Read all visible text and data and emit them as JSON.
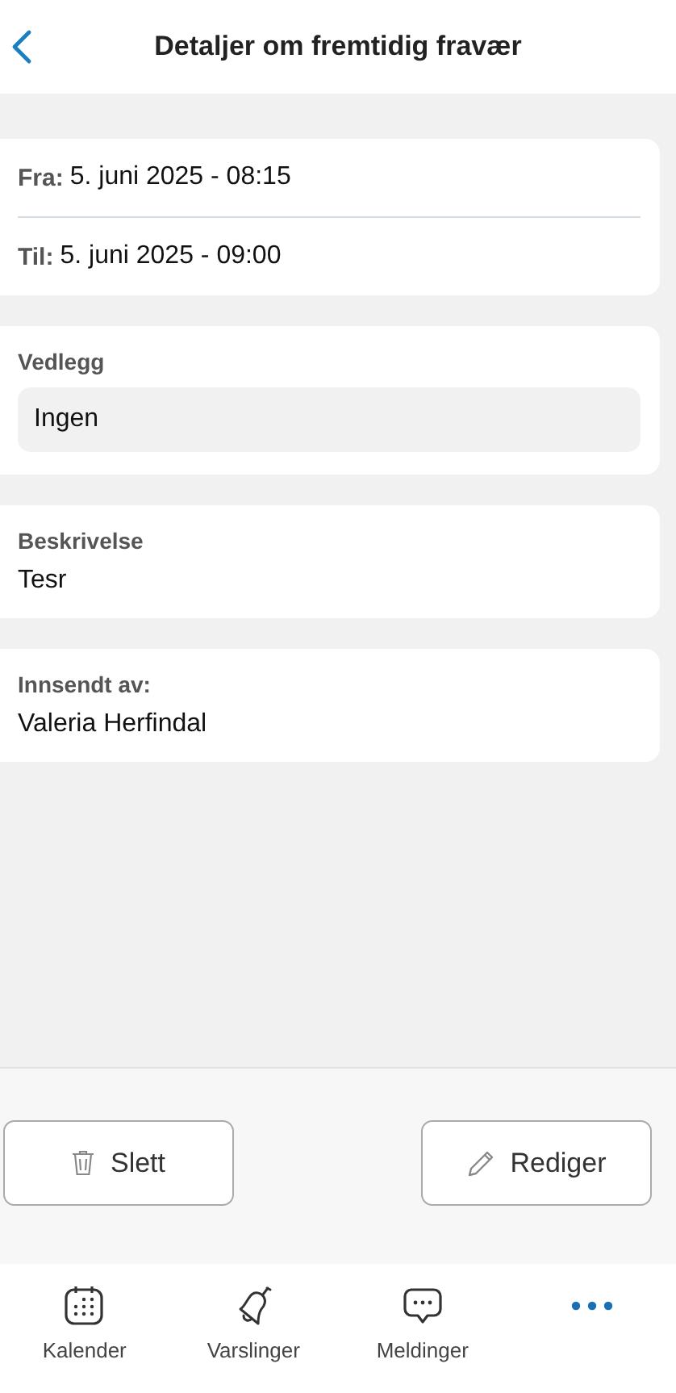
{
  "header": {
    "title": "Detaljer om fremtidig fravær"
  },
  "period": [
    {
      "label": "Fra:",
      "value": "5. juni 2025 - 08:15"
    },
    {
      "label": "Til:",
      "value": "5. juni 2025 - 09:00"
    }
  ],
  "attachments": {
    "label": "Vedlegg",
    "value": "Ingen"
  },
  "sections": [
    {
      "label": "Beskrivelse",
      "value": "Tesr"
    },
    {
      "label": "Innsendt av:",
      "value": "Valeria Herfindal"
    }
  ],
  "actions": [
    {
      "kind": "delete",
      "label": "Slett"
    },
    {
      "kind": "edit",
      "label": "Rediger"
    }
  ],
  "tabs": [
    {
      "kind": "calendar",
      "label": "Kalender",
      "selected": false
    },
    {
      "kind": "bell",
      "label": "Varslinger",
      "selected": false
    },
    {
      "kind": "chat",
      "label": "Meldinger",
      "selected": false
    },
    {
      "kind": "more",
      "selected": true
    }
  ]
}
